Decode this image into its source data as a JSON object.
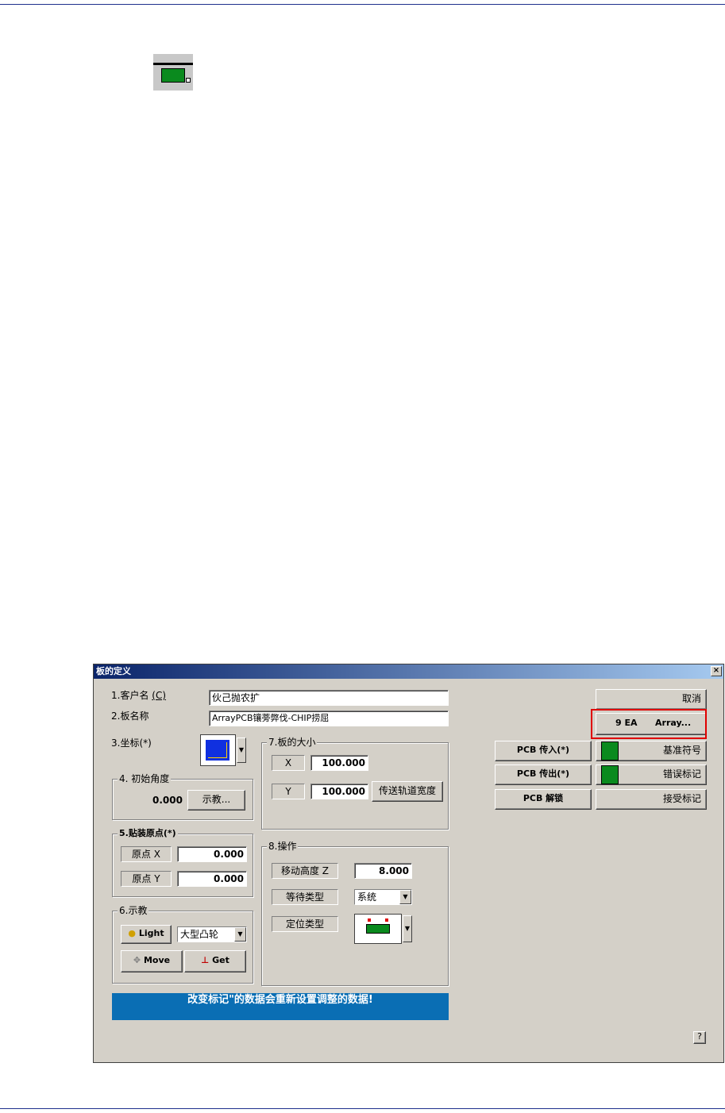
{
  "dialog": {
    "title": "板的定义",
    "close": "×",
    "customer": {
      "num": "1.客户名 ",
      "hotkey": "(C)",
      "value": "伙己抛农扩"
    },
    "board_name": {
      "label": "2.板名称",
      "value": "ArrayPCB镶蒡弊伐-CHIP捞屈"
    },
    "coord": {
      "label": "3.坐标(*)"
    },
    "initial_angle": {
      "group": "4. 初始角度",
      "value": "0.000",
      "teach_button": "示教..."
    },
    "origin": {
      "group": "5.贴装原点(*)",
      "x_label": "原点 X",
      "x_value": "0.000",
      "y_label": "原点 Y",
      "y_value": "0.000"
    },
    "teach": {
      "group": "6.示教",
      "light_button": "Light",
      "camera_select": "大型凸轮",
      "move_button": "Move",
      "get_button": "Get"
    },
    "board_size": {
      "group": "7.板的大小",
      "x_label": "X",
      "x_value": "100.000",
      "y_label": "Y",
      "y_value": "100.000",
      "conveyor_button": "传送轨道宽度"
    },
    "operation": {
      "group": "8.操作",
      "move_height_label": "移动高度 Z",
      "move_height_value": "8.000",
      "wait_type_label": "等待类型",
      "wait_type_value": "系统",
      "locate_type_label": "定位类型"
    },
    "banner": "改变标记\"的数据会重新设置调整的数据!",
    "cancel_button": "取消",
    "array": {
      "count": "9 EA",
      "button": "Array..."
    },
    "pcb_in_button": "PCB 传入(*)",
    "pcb_out_button": "PCB 传出(*)",
    "pcb_unlock_button": "PCB 解锁",
    "fiducial_button": "基准符号",
    "bad_mark_button": "错误标记",
    "accept_mark_button": "接受标记",
    "help_button": "?"
  },
  "colors": {
    "accent": "#0a6eb4",
    "green": "#0a8a1e",
    "highlight": "#e00000"
  }
}
